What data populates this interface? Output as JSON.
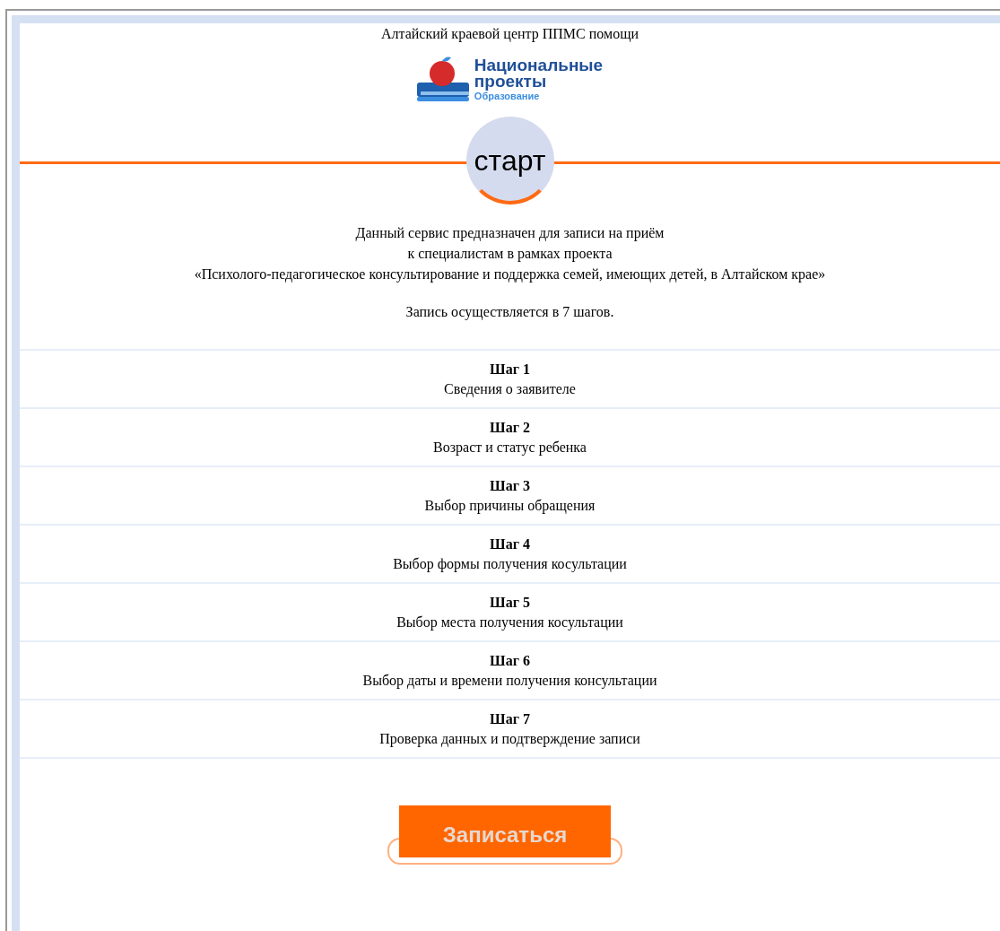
{
  "header": {
    "title": "Алтайский краевой центр ППМС помощи"
  },
  "logo": {
    "line_1": "Национальные",
    "line_2": "проекты",
    "subtitle": "Образование"
  },
  "start_badge": "старт",
  "intro": [
    "Данный сервис предназначен для записи на приём",
    "к специалистам в рамках проекта",
    "«Психолого-педагогическое консультирование и поддержка семей, имеющих детей, в Алтайском крае»"
  ],
  "steps_note": "Запись осуществляется в 7 шагов.",
  "steps": [
    {
      "label": "Шаг 1",
      "description": "Сведения о заявителе"
    },
    {
      "label": "Шаг 2",
      "description": "Возраст и статус ребенка"
    },
    {
      "label": "Шаг 3",
      "description": "Выбор причины обращения"
    },
    {
      "label": "Шаг 4",
      "description": "Выбор формы получения косультации"
    },
    {
      "label": "Шаг 5",
      "description": "Выбор места получения косультации"
    },
    {
      "label": "Шаг 6",
      "description": "Выбор даты и времени получения консультации"
    },
    {
      "label": "Шаг 7",
      "description": "Проверка данных и подтверждение записи"
    }
  ],
  "button": "Записаться"
}
